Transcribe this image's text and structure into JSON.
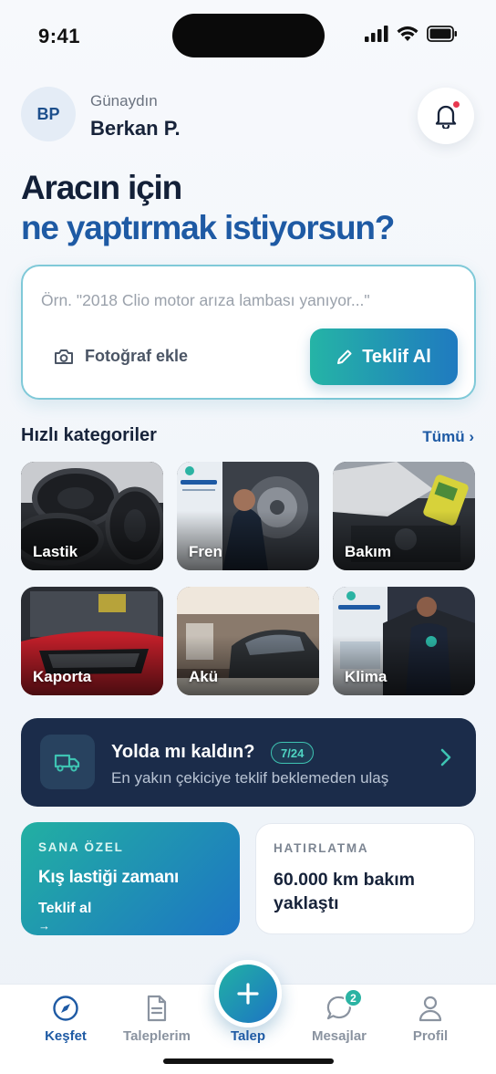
{
  "status_bar": {
    "time": "9:41"
  },
  "header": {
    "avatar_initials": "BP",
    "greeting": "Günaydın",
    "user_name": "Berkan P."
  },
  "hero": {
    "line1": "Aracın için",
    "line2": "ne yaptırmak istiyorsun?"
  },
  "request": {
    "placeholder": "Örn. \"2018 Clio motor arıza lambası yanıyor...\"",
    "value": "",
    "photo_label": "Fotoğraf ekle",
    "offer_label": "Teklif Al"
  },
  "categories": {
    "title": "Hızlı kategoriler",
    "see_all": "Tümü ›",
    "items": [
      {
        "label": "Lastik"
      },
      {
        "label": "Fren"
      },
      {
        "label": "Bakım"
      },
      {
        "label": "Kaporta"
      },
      {
        "label": "Akü"
      },
      {
        "label": "Klima"
      }
    ]
  },
  "tow": {
    "title": "Yolda mı kaldın?",
    "badge": "7/24",
    "subtitle": "En yakın çekiciye teklif beklemeden ulaş"
  },
  "promo": {
    "tag": "SANA ÖZEL",
    "title": "Kış lastiği zamanı",
    "cta": "Teklif al",
    "arrow": "→"
  },
  "reminder": {
    "tag": "HATIRLATMA",
    "title": "60.000 km bakım yaklaştı"
  },
  "tabbar": {
    "items": [
      {
        "label": "Keşfet",
        "icon": "compass-icon",
        "active": true
      },
      {
        "label": "Taleplerim",
        "icon": "document-icon"
      },
      {
        "label": "Talep",
        "icon": "plus-icon"
      },
      {
        "label": "Mesajlar",
        "icon": "chat-icon",
        "badge": "2"
      },
      {
        "label": "Profil",
        "icon": "user-icon"
      }
    ]
  },
  "colors": {
    "brand_blue": "#1e5aa4",
    "brand_teal": "#25b4a6",
    "navy": "#1b2c4a",
    "notification_dot": "#e8384f"
  }
}
